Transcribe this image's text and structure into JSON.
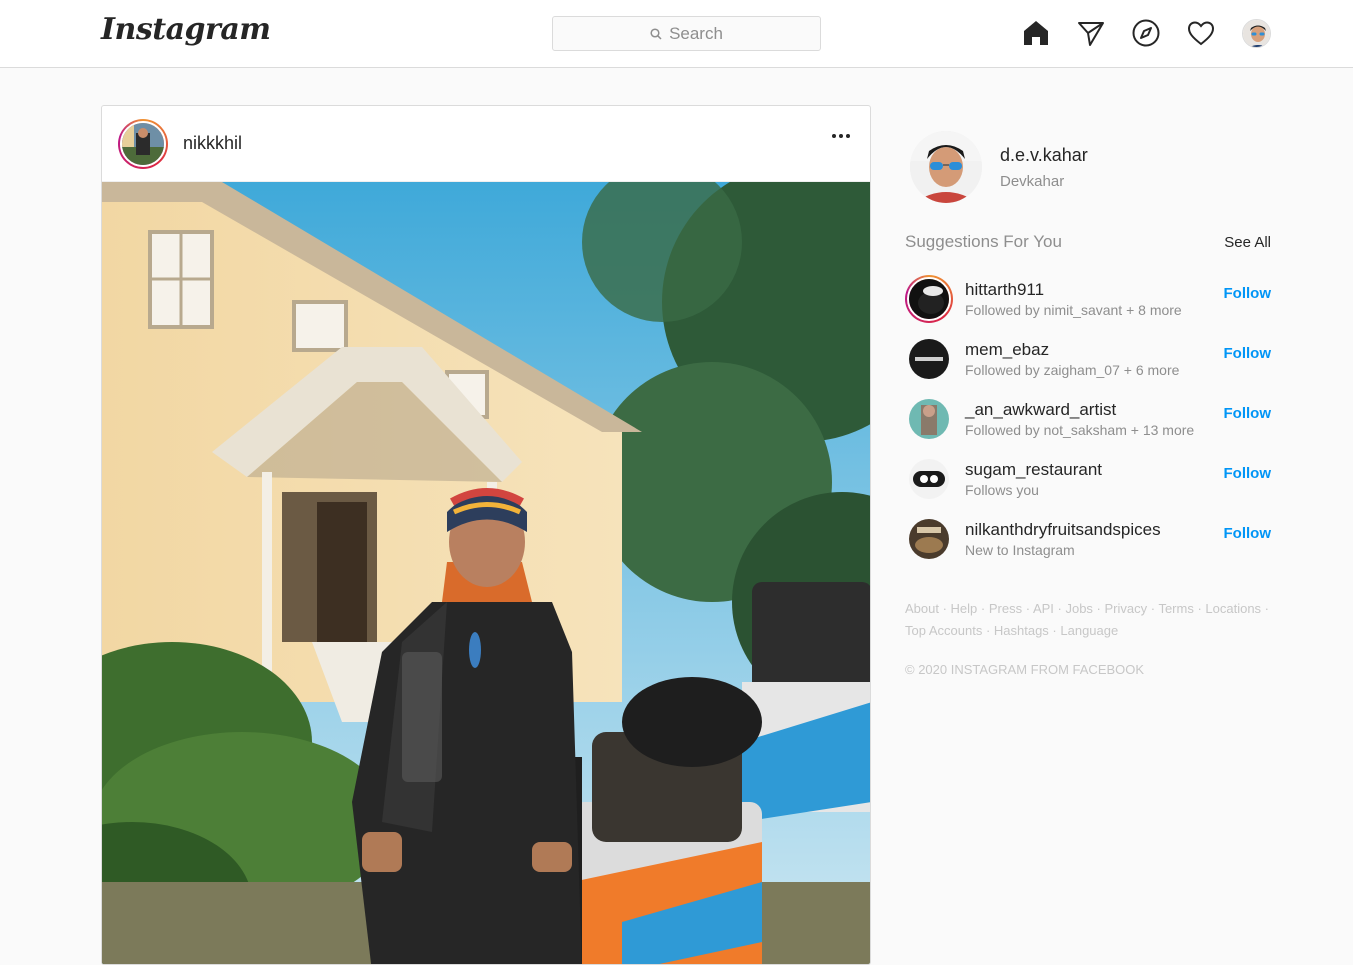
{
  "header": {
    "logo": "Instagram",
    "search_placeholder": "Search",
    "icons": [
      "home-icon",
      "direct-icon",
      "explore-icon",
      "activity-heart-icon",
      "profile-avatar"
    ]
  },
  "post": {
    "username": "nikkkhil",
    "options_icon": "more-options-icon"
  },
  "profile": {
    "username": "d.e.v.kahar",
    "name": "Devkahar"
  },
  "suggestions": {
    "title": "Suggestions For You",
    "see_all": "See All",
    "items": [
      {
        "username": "hittarth911",
        "subtitle": "Followed by nimit_savant + 8 more",
        "action": "Follow"
      },
      {
        "username": "mem_ebaz",
        "subtitle": "Followed by zaigham_07 + 6 more",
        "action": "Follow"
      },
      {
        "username": "_an_awkward_artist",
        "subtitle": "Followed by not_saksham + 13 more",
        "action": "Follow"
      },
      {
        "username": "sugam_restaurant",
        "subtitle": "Follows you",
        "action": "Follow"
      },
      {
        "username": "nilkanthdryfruitsandspices",
        "subtitle": "New to Instagram",
        "action": "Follow"
      }
    ]
  },
  "footer": {
    "links": [
      "About",
      "Help",
      "Press",
      "API",
      "Jobs",
      "Privacy",
      "Terms",
      "Locations",
      "Top Accounts",
      "Hashtags",
      "Language"
    ],
    "copyright": "© 2020 INSTAGRAM FROM FACEBOOK"
  },
  "colors": {
    "link_blue": "#0095f6",
    "border": "#dbdbdb",
    "muted_text": "#8e8e8e"
  }
}
